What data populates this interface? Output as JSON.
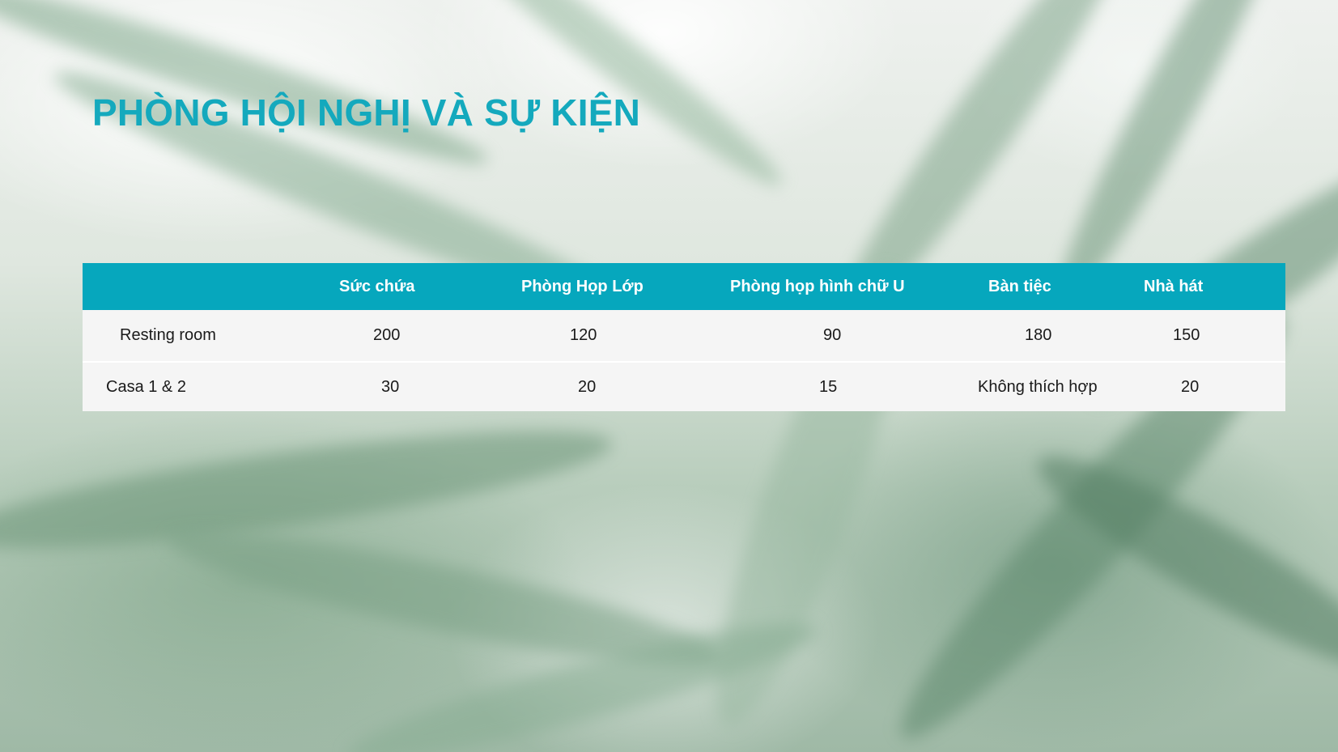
{
  "slide": {
    "title": "PHÒNG HỘI NGHỊ VÀ SỰ KIỆN"
  },
  "table": {
    "columns": [
      "",
      "Sức chứa",
      "Phòng Họp Lớp",
      "Phòng họp hình chữ U",
      "Bàn tiệc",
      "Nhà hát"
    ],
    "rows": [
      [
        "Resting room",
        "200",
        "120",
        "90",
        "180",
        "150"
      ],
      [
        "Casa 1 & 2",
        "30",
        "20",
        "15",
        "Không thích hợp",
        "20"
      ]
    ]
  },
  "colors": {
    "accent": "#14a9bd",
    "header_bg": "#06a7bd",
    "row_bg": "#f5f5f5"
  }
}
